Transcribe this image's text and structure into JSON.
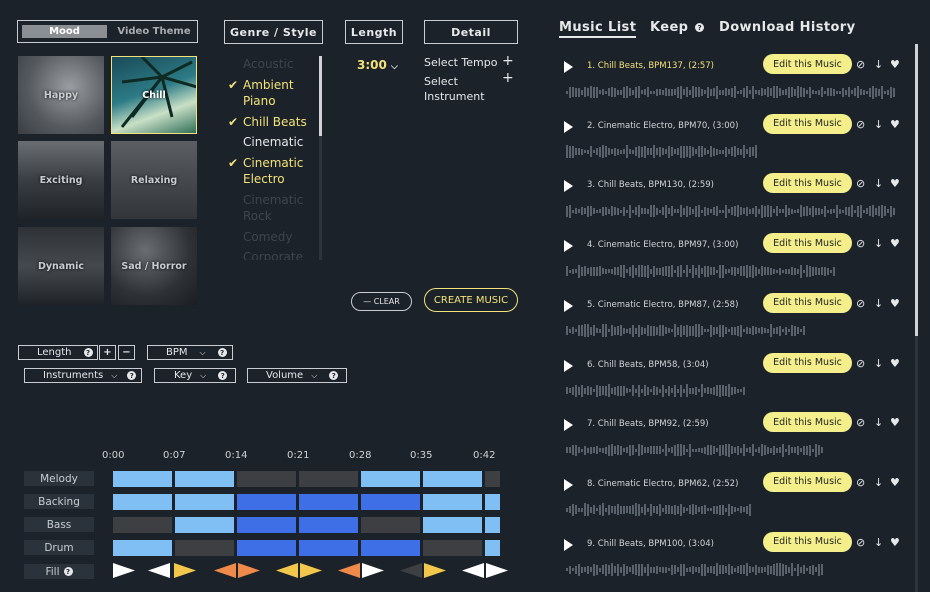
{
  "left": {
    "tabs": {
      "mood": "Mood",
      "video_theme": "Video Theme",
      "genre": "Genre / Style",
      "length": "Length",
      "detail": "Detail"
    },
    "moods": [
      {
        "label": "Happy",
        "selected": false
      },
      {
        "label": "Chill",
        "selected": true
      },
      {
        "label": "Exciting",
        "selected": false
      },
      {
        "label": "Relaxing",
        "selected": false
      },
      {
        "label": "Dynamic",
        "selected": false
      },
      {
        "label": "Sad / Horror",
        "selected": false
      }
    ],
    "genres": [
      {
        "label": "Acoustic",
        "state": "dim"
      },
      {
        "label": "Ambient Piano",
        "state": "sel"
      },
      {
        "label": "Chill Beats",
        "state": "sel"
      },
      {
        "label": "Cinematic",
        "state": "normal"
      },
      {
        "label": "Cinematic Electro",
        "state": "sel"
      },
      {
        "label": "Cinematic Rock",
        "state": "dim"
      },
      {
        "label": "Comedy",
        "state": "dim"
      },
      {
        "label": "Corporate",
        "state": "dim"
      }
    ],
    "length_value": "3:00",
    "detail": {
      "tempo": "Select Tempo",
      "instrument": "Select Instrument"
    },
    "clear": "— CLEAR",
    "create": "CREATE MUSIC",
    "controls": {
      "length": "Length",
      "bpm": "BPM",
      "instruments": "Instruments",
      "key": "Key",
      "volume": "Volume"
    },
    "timeline": [
      "0:00",
      "0:07",
      "0:14",
      "0:21",
      "0:28",
      "0:35",
      "0:42"
    ],
    "tracks": [
      "Melody",
      "Backing",
      "Bass",
      "Drum",
      "Fill"
    ]
  },
  "right": {
    "tabs": {
      "list": "Music List",
      "keep": "Keep",
      "history": "Download History"
    },
    "edit_label": "Edit this Music",
    "items": [
      {
        "num": "1.",
        "title": "Chill Beats, BPM137, (2:57)",
        "active": true
      },
      {
        "num": "2.",
        "title": "Cinematic Electro, BPM70, (3:00)",
        "active": false
      },
      {
        "num": "3.",
        "title": "Chill Beats, BPM130, (2:59)",
        "active": false
      },
      {
        "num": "4.",
        "title": "Cinematic Electro, BPM97, (3:00)",
        "active": false
      },
      {
        "num": "5.",
        "title": "Cinematic Electro, BPM87, (2:58)",
        "active": false
      },
      {
        "num": "6.",
        "title": "Chill Beats, BPM58, (3:04)",
        "active": false
      },
      {
        "num": "7.",
        "title": "Chill Beats, BPM92, (2:59)",
        "active": false
      },
      {
        "num": "8.",
        "title": "Cinematic Electro, BPM62, (2:52)",
        "active": false
      },
      {
        "num": "9.",
        "title": "Chill Beats, BPM100, (3:04)",
        "active": false
      }
    ]
  },
  "colors": {
    "accent": "#f3e27a",
    "button": "#f4ef8a",
    "light_block": "#7fbff4",
    "mid_block": "#3f6fe6",
    "gray_block": "#3d3f42",
    "orange": "#f08a4b"
  }
}
